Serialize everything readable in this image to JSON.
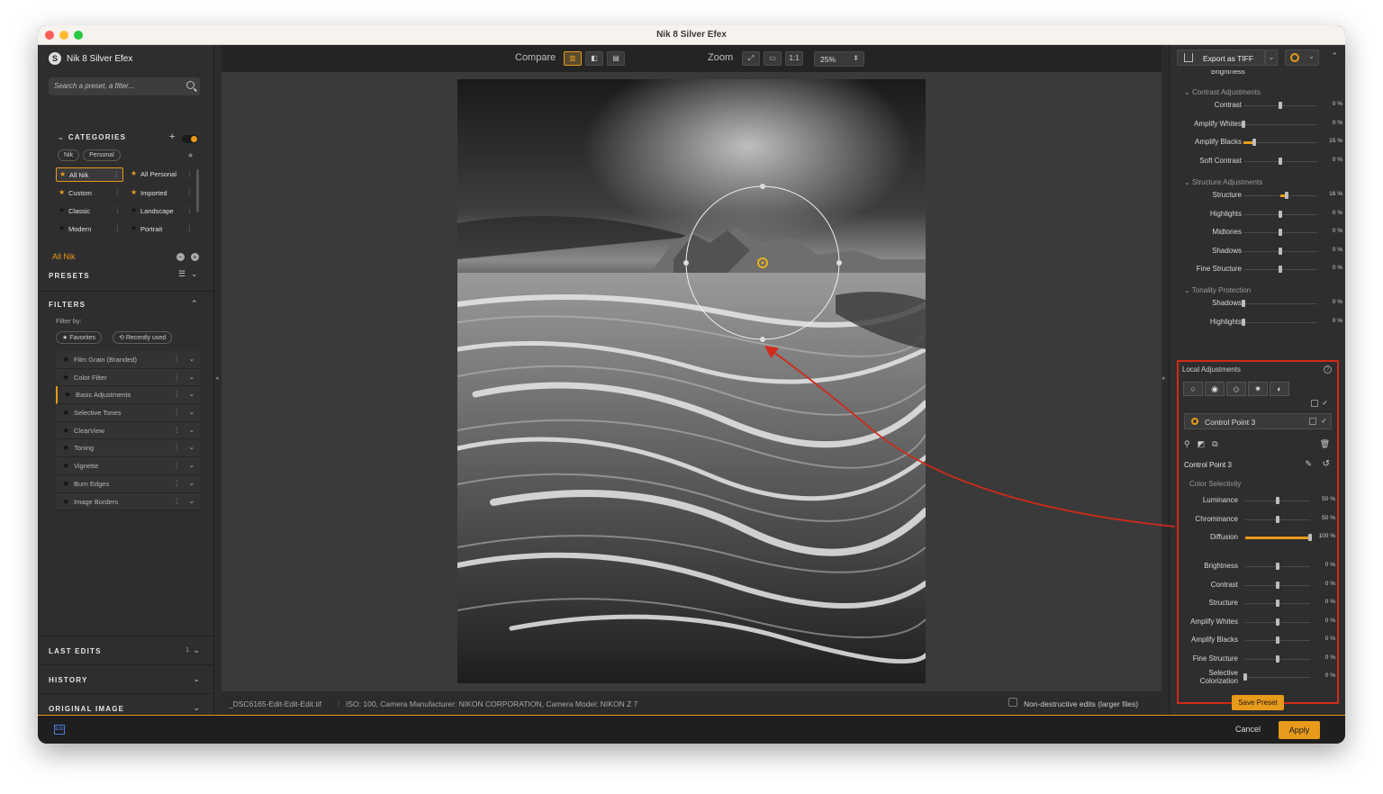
{
  "window": {
    "title": "Nik 8 Silver Efex"
  },
  "colors": {
    "accent": "#e89a1a",
    "highlight_box": "#d12a1a",
    "traffic_red": "#fe5f57",
    "traffic_yellow": "#febc2e",
    "traffic_green": "#28c840"
  },
  "sidebar": {
    "brand": "Nik 8 Silver Efex",
    "search_placeholder": "Search a preset, a filter...",
    "categories_label": "CATEGORIES",
    "tabs": [
      "Nik",
      "Personal"
    ],
    "categories": [
      {
        "label": "All Nik",
        "selected": true
      },
      {
        "label": "All Personal"
      },
      {
        "label": "Custom"
      },
      {
        "label": "Imported"
      },
      {
        "label": "Classic"
      },
      {
        "label": "Landscape"
      },
      {
        "label": "Modern"
      },
      {
        "label": "Portrait"
      }
    ],
    "current_category": "All Nik",
    "presets_label": "PRESETS",
    "filters_label": "FILTERS",
    "filter_by": "Filter by:",
    "filter_pills": [
      "★ Favorites",
      "⟲ Recently used"
    ],
    "filters": [
      "Film Grain (Branded)",
      "Color Filter",
      "Basic Adjustments",
      "Selective Tones",
      "ClearView",
      "Toning",
      "Vignette",
      "Burn Edges",
      "Image Borders"
    ],
    "active_filter": "Basic Adjustments",
    "last_edits": "LAST EDITS",
    "last_edits_count": "1",
    "history": "HISTORY",
    "original_image": "ORIGINAL IMAGE"
  },
  "toolbar": {
    "compare_label": "Compare",
    "zoom_label": "Zoom",
    "zoom_one": "1:1",
    "zoom_value": "25%"
  },
  "infobar": {
    "filename": "_DSC6165-Edit-Edit-Edit.tif",
    "meta": "ISO: 100, Camera Manufacturer: NIKON CORPORATION, Camera Model: NIKON Z 7",
    "nondestructive": "Non-destructive edits (larger files)"
  },
  "right": {
    "export_label": "Export as TIFF",
    "brightness_cut": "Brightness",
    "contrast_group": "Contrast Adjustments",
    "contrast": [
      {
        "label": "Contrast",
        "value": "0 %",
        "pos": 0.5
      },
      {
        "label": "Amplify Whites",
        "value": "0 %",
        "pos": 0.0
      },
      {
        "label": "Amplify Blacks",
        "value": "15 %",
        "pos": 0.15,
        "fill": true
      },
      {
        "label": "Soft Contrast",
        "value": "0 %",
        "pos": 0.5
      }
    ],
    "structure_group": "Structure Adjustments",
    "structure": [
      {
        "label": "Structure",
        "value": "16 %",
        "pos": 0.58,
        "fill_center": true
      },
      {
        "label": "Highlights",
        "value": "0 %",
        "pos": 0.5
      },
      {
        "label": "Midtones",
        "value": "0 %",
        "pos": 0.5
      },
      {
        "label": "Shadows",
        "value": "0 %",
        "pos": 0.5
      },
      {
        "label": "Fine Structure",
        "value": "0 %",
        "pos": 0.5
      }
    ],
    "tonality_group": "Tonality Protection",
    "tonality": [
      {
        "label": "Shadows",
        "value": "0 %",
        "pos": 0.0
      },
      {
        "label": "Highlights",
        "value": "0 %",
        "pos": 0.0
      }
    ],
    "local": {
      "title": "Local Adjustments",
      "control_point": "Control Point 3",
      "cp_name": "Control Point 3",
      "color_selectivity": "Color Selectivity",
      "selectivity": [
        {
          "label": "Luminance",
          "value": "50 %",
          "pos": 0.5
        },
        {
          "label": "Chrominance",
          "value": "50 %",
          "pos": 0.5
        },
        {
          "label": "Diffusion",
          "value": "100 %",
          "pos": 1.0,
          "fill": true
        }
      ],
      "adjust": [
        {
          "label": "Brightness",
          "value": "0 %",
          "pos": 0.5
        },
        {
          "label": "Contrast",
          "value": "0 %",
          "pos": 0.5
        },
        {
          "label": "Structure",
          "value": "0 %",
          "pos": 0.5
        },
        {
          "label": "Amplify Whites",
          "value": "0 %",
          "pos": 0.5
        },
        {
          "label": "Amplify Blacks",
          "value": "0 %",
          "pos": 0.5
        },
        {
          "label": "Fine Structure",
          "value": "0 %",
          "pos": 0.5
        },
        {
          "label": "Selective Colorization",
          "value": "0 %",
          "pos": 0.0
        }
      ]
    },
    "save_preset": "Save Preset"
  },
  "footer": {
    "lrc": "Lrc",
    "cancel": "Cancel",
    "apply": "Apply"
  }
}
